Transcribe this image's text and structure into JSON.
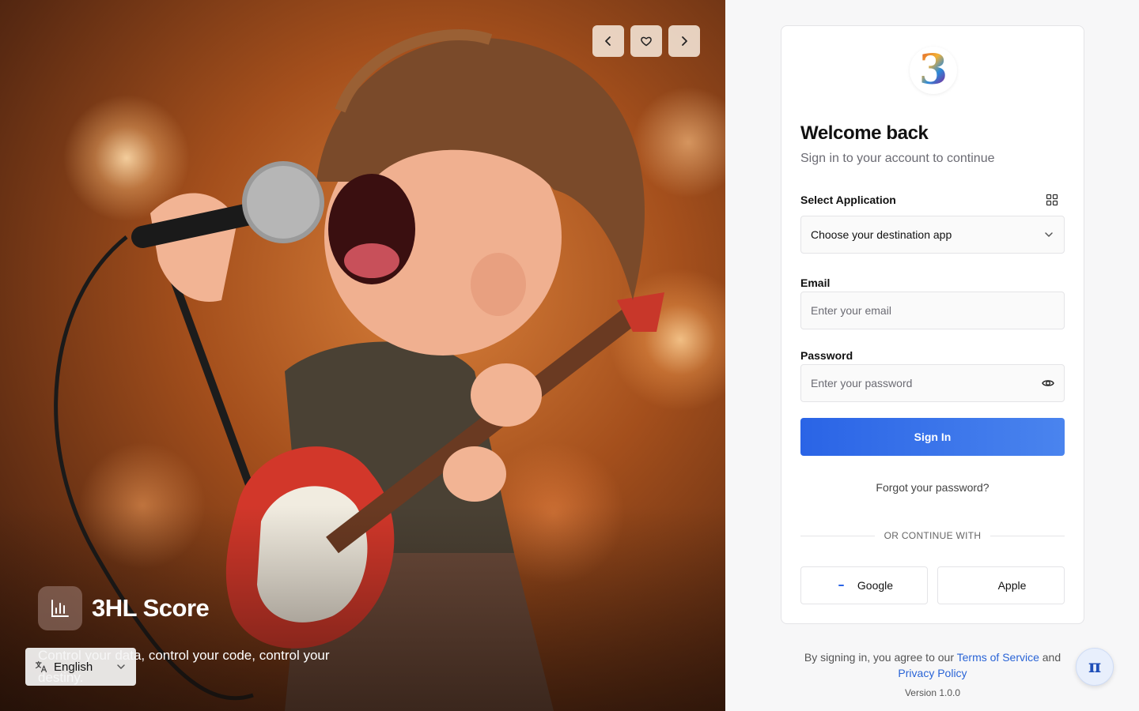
{
  "hero": {
    "image_subject": "cartoon rock singer with microphone and red electric guitar",
    "nav": {
      "prev_icon": "chevron-left-icon",
      "favorite_icon": "heart-icon",
      "next_icon": "chevron-right-icon"
    },
    "brand": {
      "logo_icon": "bar-chart-icon",
      "title": "3HL Score",
      "tagline": "Control your data, control your code, control your destiny."
    },
    "language": {
      "icon": "translate-icon",
      "selected": "English"
    }
  },
  "login": {
    "logo_glyph": "3",
    "title": "Welcome back",
    "subtitle": "Sign in to your account to continue",
    "application": {
      "label": "Select Application",
      "icon": "grid-icon",
      "value": "Choose your destination app"
    },
    "email": {
      "label": "Email",
      "placeholder": "Enter your email"
    },
    "password": {
      "label": "Password",
      "placeholder": "Enter your password",
      "toggle_icon": "eye-icon"
    },
    "sign_in_label": "Sign In",
    "forgot_label": "Forgot your password?",
    "divider_label": "OR CONTINUE WITH",
    "oauth": {
      "google_label": "Google",
      "apple_label": "Apple"
    }
  },
  "footer": {
    "legal_prefix": "By signing in, you agree to our",
    "terms_label": "Terms of Service",
    "legal_and": "and",
    "privacy_label": "Privacy Policy",
    "version": "Version 1.0.0"
  },
  "fab_glyph": "π",
  "colors": {
    "primary": "#2a64e6",
    "link": "#2a64d6",
    "hero_warm": "#a44f1c"
  }
}
